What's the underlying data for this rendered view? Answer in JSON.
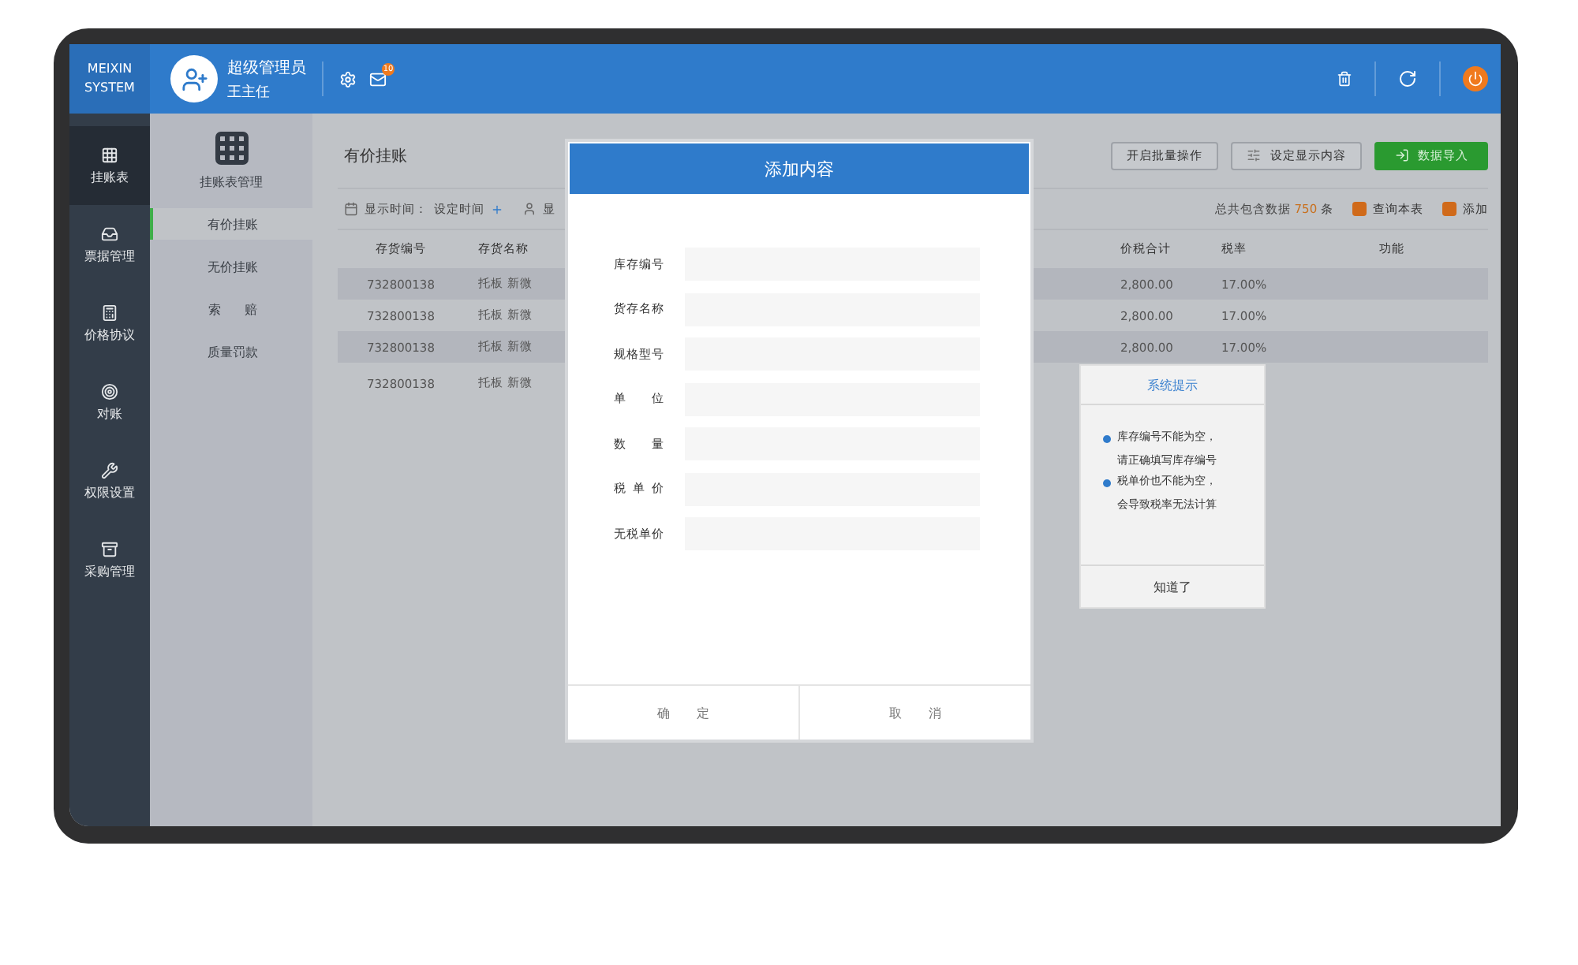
{
  "logo": [
    "MEIXIN",
    "SYSTEM"
  ],
  "user": {
    "role": "超级管理员",
    "name": "王主任",
    "mail_badge": "10"
  },
  "nav": [
    {
      "label": "挂账表",
      "selected": true
    },
    {
      "label": "票据管理",
      "selected": false
    },
    {
      "label": "价格协议",
      "selected": false
    },
    {
      "label": "对账",
      "selected": false
    },
    {
      "label": "权限设置",
      "selected": false
    },
    {
      "label": "采购管理",
      "selected": false
    }
  ],
  "subnav": {
    "title": "挂账表管理",
    "items": [
      {
        "label": "有价挂账",
        "selected": true
      },
      {
        "label": "无价挂账",
        "selected": false
      },
      {
        "label": "索 赔",
        "selected": false
      },
      {
        "label": "质量罚款",
        "selected": false
      }
    ]
  },
  "page": {
    "title": "有价挂账",
    "buttons": [
      {
        "label": "开启批量操作",
        "kind": "plain"
      },
      {
        "label": "设定显示内容",
        "kind": "icon"
      },
      {
        "label": "数据导入",
        "kind": "primary"
      }
    ],
    "time_label": "显示时间：",
    "time_value": "设定时间",
    "display_cut": "显",
    "total_prefix": "总共包含数据",
    "total_count": "750",
    "total_suffix": "条",
    "actions": [
      "查询本表",
      "添加"
    ]
  },
  "table": {
    "columns": [
      "存货编号",
      "存货名称",
      "价税合计",
      "税率",
      "功能"
    ],
    "rows": [
      {
        "code": "732800138",
        "name": "托板 新微",
        "total": "2,800.00",
        "rate": "17.00%"
      },
      {
        "code": "732800138",
        "name": "托板 新微",
        "total": "2,800.00",
        "rate": "17.00%"
      },
      {
        "code": "732800138",
        "name": "托板 新微",
        "total": "2,800.00",
        "rate": "17.00%"
      },
      {
        "code": "732800138",
        "name": "托板 新微"
      }
    ]
  },
  "dialog": {
    "title": "添加内容",
    "fields": [
      "库存编号",
      "货存名称",
      "规格型号",
      "单 位",
      "数 量",
      "税 单 价",
      "无税单价"
    ],
    "buttons": [
      "确 定",
      "取 消"
    ]
  },
  "alert": {
    "title": "系统提示",
    "messages": [
      [
        "库存编号不能为空，",
        "请正确填写库存编号"
      ],
      [
        "税单价也不能为空，",
        "会导致税率无法计算"
      ]
    ],
    "button": "知道了"
  }
}
